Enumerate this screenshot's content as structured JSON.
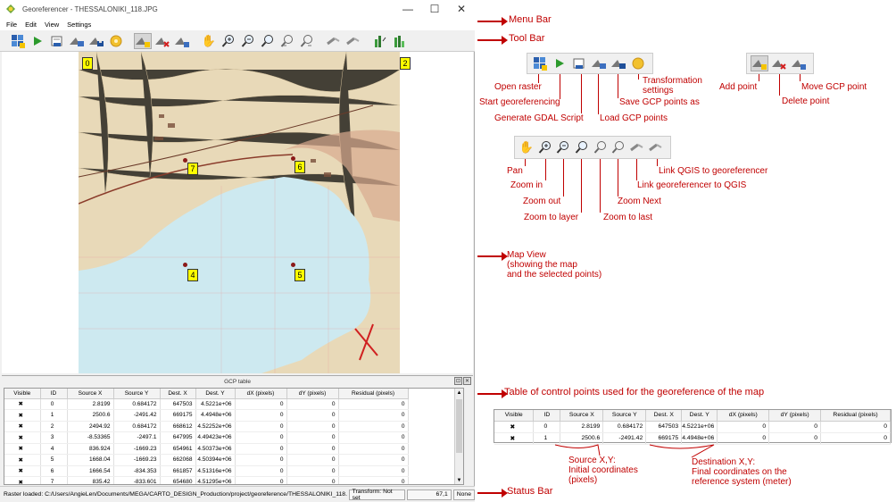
{
  "window": {
    "title": "Georeferencer - THESSALONIKI_118.JPG",
    "min_glyph": "—",
    "max_glyph": "☐",
    "close_glyph": "✕"
  },
  "menu": [
    "File",
    "Edit",
    "View",
    "Settings"
  ],
  "map": {
    "corners": {
      "tl": "0",
      "tr": "2"
    },
    "gcp_labels": {
      "p7": "7",
      "p6": "6",
      "p4": "4",
      "p5": "5"
    }
  },
  "gcp_table": {
    "title": "GCP table",
    "float_btn": "⊡",
    "close_btn": "✕",
    "scroll_up": "▲",
    "scroll_down": "▼",
    "headers": [
      "Visible",
      "ID",
      "Source X",
      "Source Y",
      "Dest. X",
      "Dest. Y",
      "dX (pixels)",
      "dY (pixels)",
      "Residual (pixels)"
    ],
    "rows": [
      [
        "✖",
        "0",
        "2.8199",
        "0.684172",
        "647503",
        "4.5221e+06",
        "0",
        "0",
        "0"
      ],
      [
        "✖",
        "1",
        "2500.6",
        "-2491.42",
        "669175",
        "4.4948e+06",
        "0",
        "0",
        "0"
      ],
      [
        "✖",
        "2",
        "2494.92",
        "0.684172",
        "668612",
        "4.52252e+06",
        "0",
        "0",
        "0"
      ],
      [
        "✖",
        "3",
        "-8.53365",
        "-2497.1",
        "647995",
        "4.49423e+06",
        "0",
        "0",
        "0"
      ],
      [
        "✖",
        "4",
        "836.924",
        "-1669.23",
        "654961",
        "4.50373e+06",
        "0",
        "0",
        "0"
      ],
      [
        "✖",
        "5",
        "1668.04",
        "-1669.23",
        "662068",
        "4.50394e+06",
        "0",
        "0",
        "0"
      ],
      [
        "✖",
        "6",
        "1666.54",
        "-834.353",
        "661857",
        "4.51316e+06",
        "0",
        "0",
        "0"
      ],
      [
        "✖",
        "7",
        "835.42",
        "-833.601",
        "654680",
        "4.51295e+06",
        "0",
        "0",
        "0"
      ]
    ]
  },
  "statusbar": {
    "message": "Raster loaded: C:/Users/AngieLen/Documents/MEGA/CARTO_DESIGN_Production/project/georeference/THESSALONIKI_118.JPG",
    "transform": "Transform: Not set",
    "coords": "67,1",
    "crs": "None"
  },
  "annotations": {
    "menu_bar": "Menu Bar",
    "tool_bar": "Tool Bar",
    "open_raster": "Open raster",
    "start_georef": "Start georeferencing",
    "gdal_script": "Generate GDAL Script",
    "load_gcp": "Load GCP points",
    "save_gcp": "Save GCP points as",
    "transform_settings": "Transformation\nsettings",
    "add_point": "Add point",
    "delete_point": "Delete point",
    "move_gcp": "Move GCP point",
    "pan": "Pan",
    "zoom_in": "Zoom in",
    "zoom_out": "Zoom out",
    "zoom_layer": "Zoom to layer",
    "zoom_next": "Zoom Next",
    "zoom_last": "Zoom to last",
    "link_qgis_georef": "Link QGIS to georeferencer",
    "link_georef_qgis": "Link georeferencer to QGIS",
    "map_view": "Map View\n(showing the map\nand the selected points)",
    "table_cp": "Table of control points used for the georeference of the map",
    "source_xy": "Source X,Y:\nInitial coordinates\n(pixels)",
    "dest_xy": "Destination X,Y:\nFinal coordinates on the\nreference system (meter)",
    "status_bar": "Status Bar"
  },
  "zoom_table": {
    "headers": [
      "Visible",
      "ID",
      "Source X",
      "Source Y",
      "Dest. X",
      "Dest. Y",
      "dX (pixels)",
      "dY (pixels)",
      "Residual (pixels)"
    ],
    "rows": [
      [
        "✖",
        "0",
        "2.8199",
        "0.684172",
        "647503",
        "4.5221e+06",
        "0",
        "0",
        "0"
      ],
      [
        "✖",
        "1",
        "2500.6",
        "-2491.42",
        "669175",
        "4.4948e+06",
        "0",
        "0",
        "0"
      ]
    ]
  },
  "colors": {
    "annotation": "#c00000",
    "gcp_label": "#ffff00",
    "sea": "#cde9f0",
    "land": "#e8d9b8"
  }
}
